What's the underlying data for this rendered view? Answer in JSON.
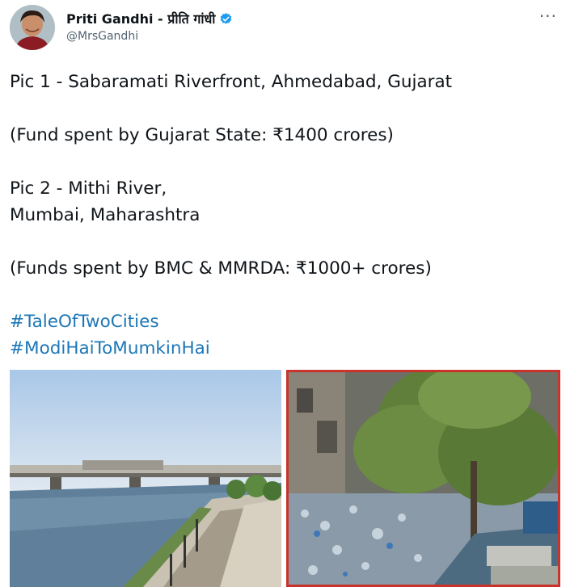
{
  "author": {
    "display_name": "Priti Gandhi - प्रीति गांधी",
    "handle": "@MrsGandhi",
    "more_icon": "more-icon",
    "verified_icon": "verified-badge-icon",
    "accent_color": "#1d9bf0"
  },
  "tweet": {
    "lines": [
      "Pic 1 - Sabaramati Riverfront, Ahmedabad, Gujarat",
      "",
      "(Fund spent by Gujarat State: ₹1400 crores)",
      "",
      "Pic 2 - Mithi River,",
      "Mumbai, Maharashtra",
      "",
      "(Funds spent by BMC & MMRDA: ₹1000+ crores)",
      ""
    ],
    "hashtags": [
      "#TaleOfTwoCities",
      "#ModiHaiToMumkinHai"
    ],
    "hashtag_color": "#1d77b7"
  },
  "media": {
    "pic1": "riverfront-photo",
    "pic2": "polluted-river-photo",
    "pic2_border_color": "#c8332b"
  }
}
